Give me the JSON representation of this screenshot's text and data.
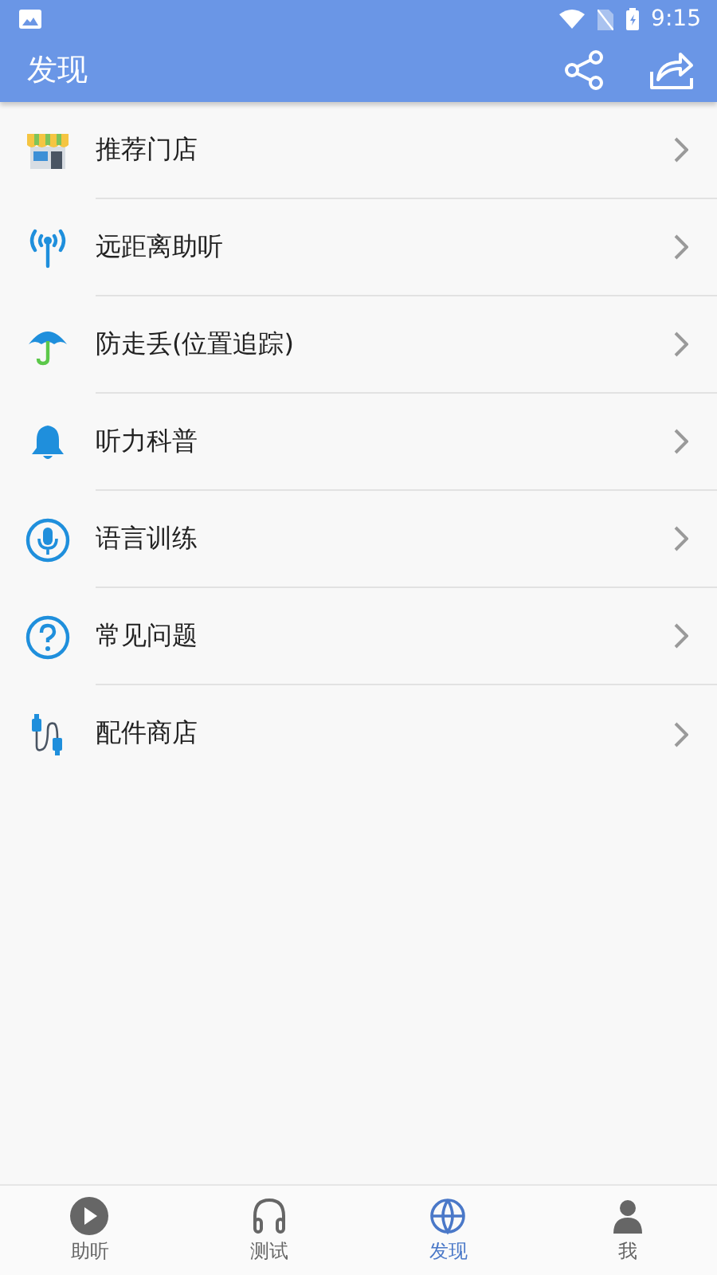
{
  "status_bar": {
    "time": "9:15"
  },
  "toolbar": {
    "title": "发现"
  },
  "items": [
    {
      "kind": "store",
      "label": "推荐门店"
    },
    {
      "kind": "antenna",
      "label": "远距离助听"
    },
    {
      "kind": "umbrella",
      "label": "防走丢(位置追踪)"
    },
    {
      "kind": "bell",
      "label": "听力科普"
    },
    {
      "kind": "mic",
      "label": "语言训练"
    },
    {
      "kind": "question",
      "label": "常见问题"
    },
    {
      "kind": "cable",
      "label": "配件商店"
    }
  ],
  "bottom_nav": [
    {
      "kind": "play",
      "label": "助听",
      "selected": false
    },
    {
      "kind": "headphones",
      "label": "测试",
      "selected": false
    },
    {
      "kind": "globe",
      "label": "发现",
      "selected": true
    },
    {
      "kind": "person",
      "label": "我",
      "selected": false
    }
  ]
}
